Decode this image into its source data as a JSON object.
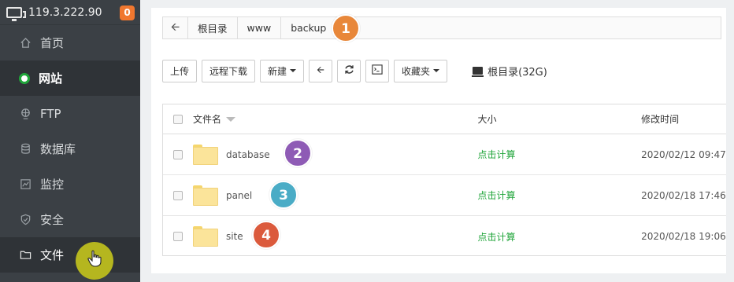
{
  "sidebar": {
    "ip": "119.3.222.90",
    "badge": "0",
    "items": [
      {
        "label": "首页",
        "icon": "home-icon"
      },
      {
        "label": "网站",
        "icon": "website-icon",
        "active": true
      },
      {
        "label": "FTP",
        "icon": "ftp-icon"
      },
      {
        "label": "数据库",
        "icon": "database-icon"
      },
      {
        "label": "监控",
        "icon": "monitor-icon"
      },
      {
        "label": "安全",
        "icon": "shield-icon"
      },
      {
        "label": "文件",
        "icon": "folder-icon"
      }
    ]
  },
  "breadcrumb": {
    "items": [
      "根目录",
      "www",
      "backup"
    ]
  },
  "toolbar": {
    "upload": "上传",
    "remote_download": "远程下载",
    "new": "新建",
    "favorites": "收藏夹",
    "disk": "根目录(32G)"
  },
  "table": {
    "headers": {
      "name": "文件名",
      "size": "大小",
      "time": "修改时间"
    },
    "rows": [
      {
        "name": "database",
        "size": "点击计算",
        "time": "2020/02/12 09:47"
      },
      {
        "name": "panel",
        "size": "点击计算",
        "time": "2020/02/18 17:46"
      },
      {
        "name": "site",
        "size": "点击计算",
        "time": "2020/02/18 19:06"
      }
    ]
  },
  "annotations": {
    "one": "1",
    "two": "2",
    "three": "3",
    "four": "4"
  },
  "colors": {
    "accent_green": "#20a53a",
    "badge_orange": "#f0772f",
    "marker1": "#e8873a",
    "marker2": "#8e5bb5",
    "marker3": "#4aacc6",
    "marker4": "#db5a3c",
    "cursor_glow": "#b5b61f"
  }
}
